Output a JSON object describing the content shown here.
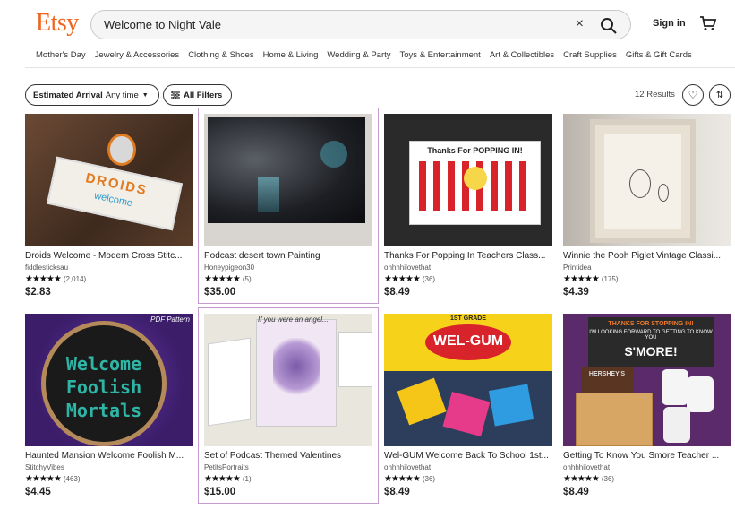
{
  "header": {
    "logo": "Etsy",
    "search_value": "Welcome to Night Vale",
    "clear_icon": "×",
    "signin": "Sign in",
    "categories": [
      "Mother's Day",
      "Jewelry & Accessories",
      "Clothing & Shoes",
      "Home & Living",
      "Wedding & Party",
      "Toys & Entertainment",
      "Art & Collectibles",
      "Craft Supplies",
      "Gifts & Gift Cards"
    ]
  },
  "filters": {
    "estimated_label": "Estimated Arrival",
    "estimated_value": "Any time",
    "all_filters": "All Filters",
    "results": "12 Results"
  },
  "listings": [
    {
      "title": "Droids Welcome - Modern Cross Stitc...",
      "shop": "fiddlesticksau",
      "stars": "★★★★★",
      "count": "(2,014)",
      "price": "$2.83",
      "highlight": false
    },
    {
      "title": "Podcast desert town Painting",
      "shop": "Honeypigeon30",
      "stars": "★★★★★",
      "count": "(5)",
      "price": "$35.00",
      "highlight": true
    },
    {
      "title": "Thanks For Popping In Teachers Class...",
      "shop": "ohhhhilovethat",
      "stars": "★★★★★",
      "count": "(36)",
      "price": "$8.49",
      "highlight": false
    },
    {
      "title": "Winnie the Pooh Piglet Vintage Classi...",
      "shop": "Printidea",
      "stars": "★★★★★",
      "count": "(175)",
      "price": "$4.39",
      "highlight": false
    },
    {
      "title": "Haunted Mansion Welcome Foolish M...",
      "shop": "StitchyVibes",
      "stars": "★★★★★",
      "count": "(463)",
      "price": "$4.45",
      "highlight": false
    },
    {
      "title": "Set of Podcast Themed Valentines",
      "shop": "PetitsPortraits",
      "stars": "★★★★★",
      "count": "(1)",
      "price": "$15.00",
      "highlight": true
    },
    {
      "title": "Wel-GUM Welcome Back To School 1st...",
      "shop": "ohhhhilovethat",
      "stars": "★★★★★",
      "count": "(36)",
      "price": "$8.49",
      "highlight": false
    },
    {
      "title": "Getting To Know You Smore Teacher ...",
      "shop": "ohhhhilovethat",
      "stars": "★★★★★",
      "count": "(36)",
      "price": "$8.49",
      "highlight": false
    }
  ],
  "thumb_text": {
    "droids": "DROIDS",
    "welcome_small": "welcome",
    "popping": "Thanks For POPPING IN!",
    "pdf": "PDF Pattern",
    "haunted": [
      "Welcome",
      "Foolish",
      "Mortals"
    ],
    "valentine_note": "If you were an angel...",
    "grade": "1ST GRADE",
    "welgum": "WEL-GUM",
    "smore_top": "THANKS FOR STOPPING IN!",
    "smore_mid": "I'M LOOKING FORWARD TO GETTING TO KNOW YOU",
    "smore": "S'MORE!",
    "hershey": "HERSHEY'S"
  },
  "colors": {
    "brand": "#f1641e",
    "highlight": "#c79bd1"
  }
}
